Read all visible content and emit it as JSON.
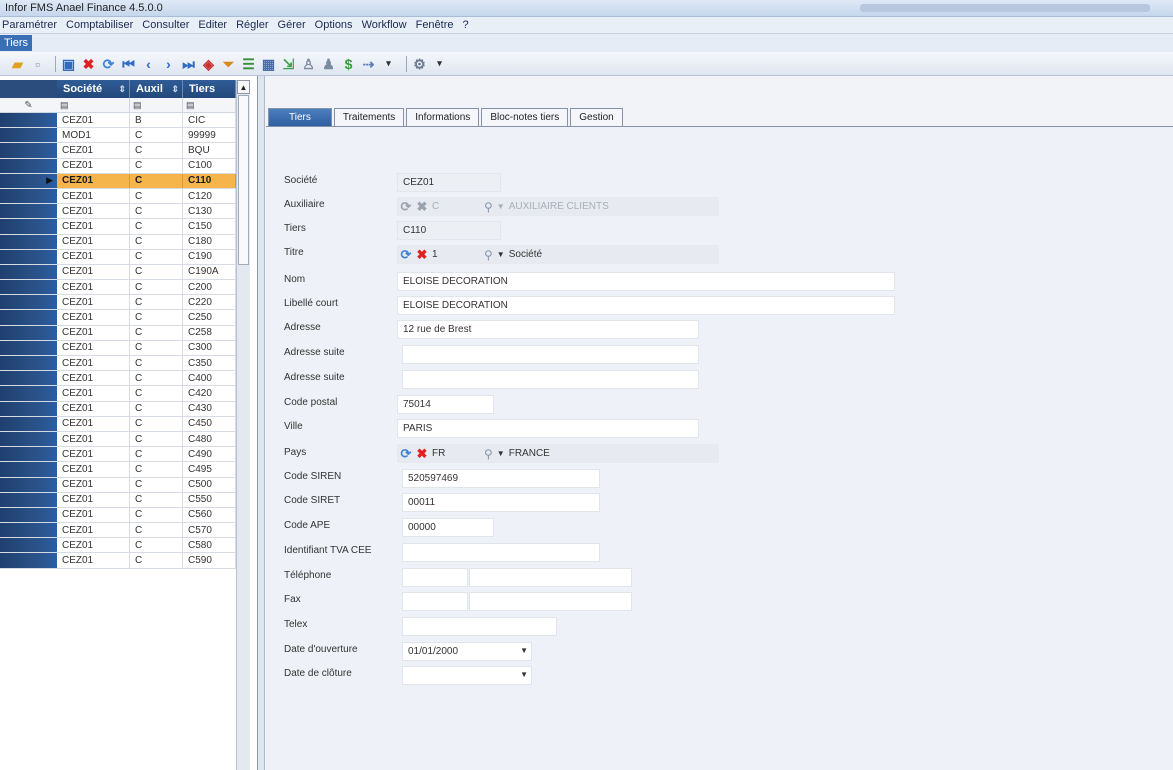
{
  "app": {
    "title": "Infor FMS Anael Finance 4.5.0.0"
  },
  "menu": [
    "Paramétrer",
    "Comptabiliser",
    "Consulter",
    "Editer",
    "Régler",
    "Gérer",
    "Options",
    "Workflow",
    "Fenêtre",
    "?"
  ],
  "doc_tab": "Tiers",
  "grid": {
    "columns": [
      "Société",
      "Auxil",
      "Tiers"
    ],
    "filter_icon": "filter-icon",
    "rows": [
      {
        "societe": "CEZ01",
        "auxil": "B",
        "tiers": "CIC"
      },
      {
        "societe": "MOD1",
        "auxil": "C",
        "tiers": "99999"
      },
      {
        "societe": "CEZ01",
        "auxil": "C",
        "tiers": "BQU"
      },
      {
        "societe": "CEZ01",
        "auxil": "C",
        "tiers": "C100"
      },
      {
        "societe": "CEZ01",
        "auxil": "C",
        "tiers": "C110"
      },
      {
        "societe": "CEZ01",
        "auxil": "C",
        "tiers": "C120"
      },
      {
        "societe": "CEZ01",
        "auxil": "C",
        "tiers": "C130"
      },
      {
        "societe": "CEZ01",
        "auxil": "C",
        "tiers": "C150"
      },
      {
        "societe": "CEZ01",
        "auxil": "C",
        "tiers": "C180"
      },
      {
        "societe": "CEZ01",
        "auxil": "C",
        "tiers": "C190"
      },
      {
        "societe": "CEZ01",
        "auxil": "C",
        "tiers": "C190A"
      },
      {
        "societe": "CEZ01",
        "auxil": "C",
        "tiers": "C200"
      },
      {
        "societe": "CEZ01",
        "auxil": "C",
        "tiers": "C220"
      },
      {
        "societe": "CEZ01",
        "auxil": "C",
        "tiers": "C250"
      },
      {
        "societe": "CEZ01",
        "auxil": "C",
        "tiers": "C258"
      },
      {
        "societe": "CEZ01",
        "auxil": "C",
        "tiers": "C300"
      },
      {
        "societe": "CEZ01",
        "auxil": "C",
        "tiers": "C350"
      },
      {
        "societe": "CEZ01",
        "auxil": "C",
        "tiers": "C400"
      },
      {
        "societe": "CEZ01",
        "auxil": "C",
        "tiers": "C420"
      },
      {
        "societe": "CEZ01",
        "auxil": "C",
        "tiers": "C430"
      },
      {
        "societe": "CEZ01",
        "auxil": "C",
        "tiers": "C450"
      },
      {
        "societe": "CEZ01",
        "auxil": "C",
        "tiers": "C480"
      },
      {
        "societe": "CEZ01",
        "auxil": "C",
        "tiers": "C490"
      },
      {
        "societe": "CEZ01",
        "auxil": "C",
        "tiers": "C495"
      },
      {
        "societe": "CEZ01",
        "auxil": "C",
        "tiers": "C500"
      },
      {
        "societe": "CEZ01",
        "auxil": "C",
        "tiers": "C550"
      },
      {
        "societe": "CEZ01",
        "auxil": "C",
        "tiers": "C560"
      },
      {
        "societe": "CEZ01",
        "auxil": "C",
        "tiers": "C570"
      },
      {
        "societe": "CEZ01",
        "auxil": "C",
        "tiers": "C580"
      },
      {
        "societe": "CEZ01",
        "auxil": "C",
        "tiers": "C590"
      }
    ]
  },
  "tabs": [
    "Tiers",
    "Traitements",
    "Informations",
    "Bloc-notes tiers",
    "Gestion"
  ],
  "form": {
    "societe": {
      "label": "Société",
      "value": "CEZ01"
    },
    "auxiliaire": {
      "label": "Auxiliaire",
      "code": "C",
      "desc": "AUXILIAIRE CLIENTS"
    },
    "tiers": {
      "label": "Tiers",
      "value": "C110"
    },
    "titre": {
      "label": "Titre",
      "code": "1",
      "desc": "Société"
    },
    "nom": {
      "label": "Nom",
      "value": "ELOISE DECORATION"
    },
    "libelle_court": {
      "label": "Libellé court",
      "value": "ELOISE DECORATION"
    },
    "adresse": {
      "label": "Adresse",
      "value": "12 rue de Brest"
    },
    "adresse_suite1": {
      "label": "Adresse suite",
      "value": ""
    },
    "adresse_suite2": {
      "label": "Adresse suite",
      "value": ""
    },
    "code_postal": {
      "label": "Code postal",
      "value": "75014"
    },
    "ville": {
      "label": "Ville",
      "value": "PARIS"
    },
    "pays": {
      "label": "Pays",
      "code": "FR",
      "desc": "FRANCE"
    },
    "code_siren": {
      "label": "Code SIREN",
      "value": "520597469"
    },
    "code_siret": {
      "label": "Code SIRET",
      "value": "00011"
    },
    "code_ape": {
      "label": "Code APE",
      "value": "00000"
    },
    "tva_cee": {
      "label": "Identifiant TVA CEE",
      "value": ""
    },
    "telephone": {
      "label": "Téléphone",
      "value": ""
    },
    "fax": {
      "label": "Fax",
      "value": ""
    },
    "telex": {
      "label": "Telex",
      "value": ""
    },
    "date_ouverture": {
      "label": "Date d'ouverture",
      "value": "01/01/2000"
    },
    "date_cloture": {
      "label": "Date de clôture",
      "value": ""
    }
  }
}
